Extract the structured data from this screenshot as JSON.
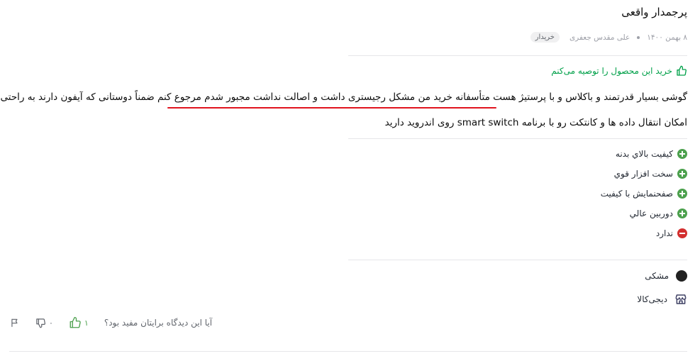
{
  "review": {
    "title": "پرجمدار واقعی",
    "date": "۸ بهمن ۱۴۰۰",
    "author": "علی مقدس جعفری",
    "badge": "خریدار",
    "recommendation": "خرید این محصول را توصیه می‌کنم",
    "body_line1": "گوشی بسیار قدرتمند و باکلاس و با پرستیژ هست متأسفانه خرید من مشکل رجیستری داشت و اصالت نداشت مجبور شدم مرجوع کنم ضمناً دوستانی که آیفون دارند به راحتی",
    "body_line2": "امکان انتقال داده ها و کانتکت رو با برنامه smart switch روی اندروید دارید",
    "positives": [
      "کیفیت بالاي بدنه",
      "سخت افزار قوي",
      "صفحنمایش با کیفیت",
      "دوربین عالي"
    ],
    "negatives": [
      "ندارد"
    ],
    "color": "مشکی",
    "color_hex": "#212121",
    "seller": "دیجی‌کالا",
    "helpful_question": "آیا این دیدگاه برایتان مفید بود؟",
    "likes": "۱",
    "dislikes": "۰"
  },
  "colors": {
    "accent_green": "#00a049",
    "plus_green": "#4ca04d",
    "minus_red": "#d32f2f",
    "underline_red": "#e0141e"
  },
  "icons": [
    "thumbs-up-icon",
    "plus-circle-icon",
    "minus-circle-icon",
    "store-icon",
    "thumbs-down-icon",
    "flag-icon"
  ]
}
